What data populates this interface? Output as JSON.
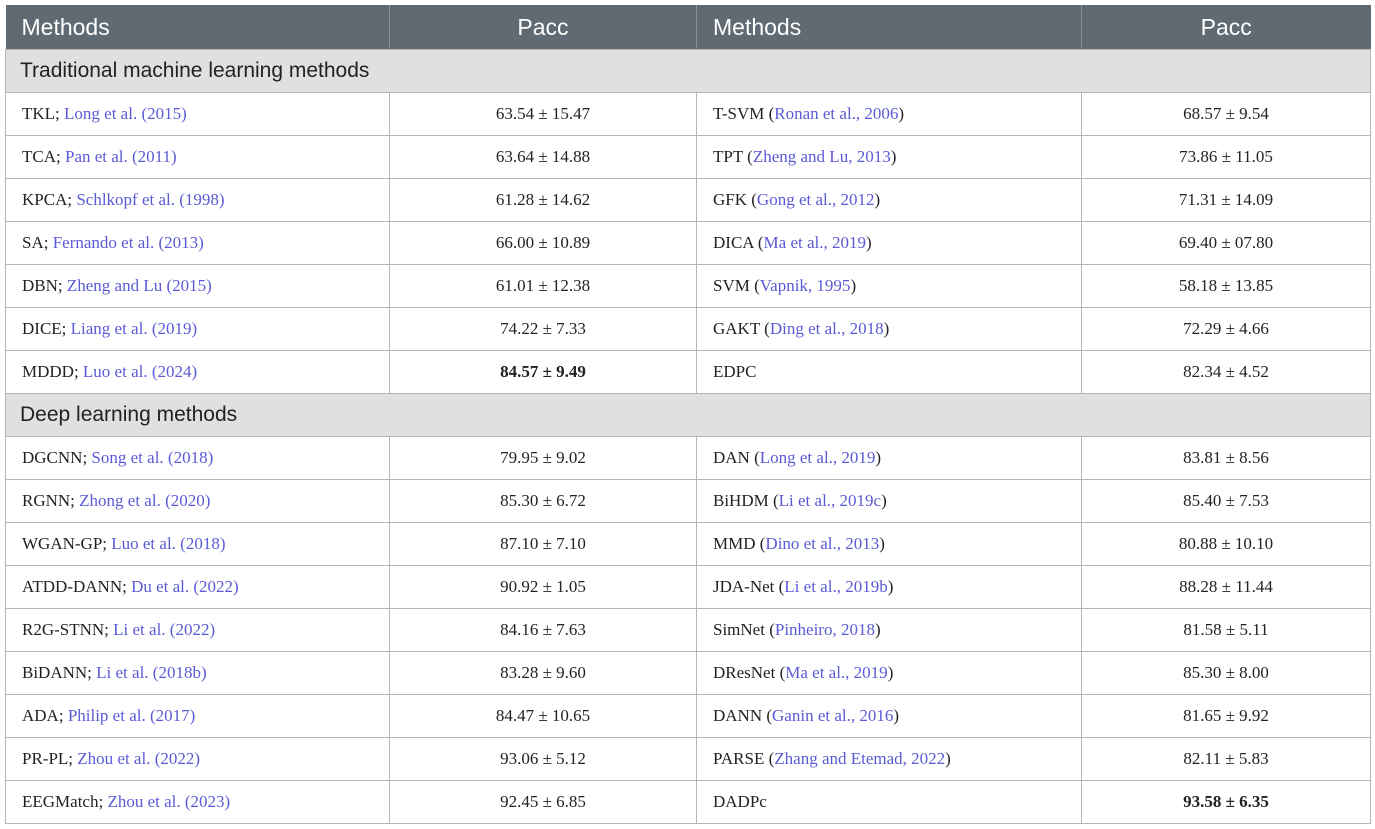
{
  "headers": [
    "Methods",
    "Pacc",
    "Methods",
    "Pacc"
  ],
  "sections": [
    {
      "title": "Traditional machine learning methods",
      "rows": [
        {
          "m1": "TKL; ",
          "r1": "Long et al. (2015)",
          "e1": "",
          "v1": "63.54 ± 15.47",
          "b1": false,
          "m2": "T-SVM (",
          "r2": "Ronan et al., 2006",
          "e2": ")",
          "v2": "68.57 ± 9.54",
          "b2": false
        },
        {
          "m1": "TCA; ",
          "r1": "Pan et al. (2011)",
          "e1": "",
          "v1": "63.64 ± 14.88",
          "b1": false,
          "m2": "TPT (",
          "r2": "Zheng and Lu, 2013",
          "e2": ")",
          "v2": "73.86 ± 11.05",
          "b2": false
        },
        {
          "m1": "KPCA; ",
          "r1": "Schlkopf et al. (1998)",
          "e1": "",
          "v1": "61.28 ± 14.62",
          "b1": false,
          "m2": "GFK (",
          "r2": "Gong et al., 2012",
          "e2": ")",
          "v2": "71.31 ± 14.09",
          "b2": false
        },
        {
          "m1": "SA; ",
          "r1": "Fernando et al. (2013)",
          "e1": "",
          "v1": "66.00 ± 10.89",
          "b1": false,
          "m2": "DICA (",
          "r2": "Ma et al., 2019",
          "e2": ")",
          "v2": "69.40 ± 07.80",
          "b2": false
        },
        {
          "m1": "DBN; ",
          "r1": "Zheng and Lu (2015)",
          "e1": "",
          "v1": "61.01 ± 12.38",
          "b1": false,
          "m2": "SVM (",
          "r2": "Vapnik, 1995",
          "e2": ")",
          "v2": "58.18 ± 13.85",
          "b2": false
        },
        {
          "m1": "DICE; ",
          "r1": "Liang et al. (2019)",
          "e1": "",
          "v1": "74.22 ± 7.33",
          "b1": false,
          "m2": "GAKT (",
          "r2": "Ding et al., 2018",
          "e2": ")",
          "v2": "72.29 ± 4.66",
          "b2": false
        },
        {
          "m1": "MDDD; ",
          "r1": "Luo et al. (2024)",
          "e1": "",
          "v1": "84.57 ± 9.49",
          "b1": true,
          "m2": "EDPC",
          "r2": "",
          "e2": "",
          "v2": "82.34 ± 4.52",
          "b2": false
        }
      ]
    },
    {
      "title": "Deep learning methods",
      "rows": [
        {
          "m1": "DGCNN; ",
          "r1": "Song et al. (2018)",
          "e1": "",
          "v1": "79.95 ± 9.02",
          "b1": false,
          "m2": "DAN (",
          "r2": "Long et al., 2019",
          "e2": ")",
          "v2": "83.81 ± 8.56",
          "b2": false
        },
        {
          "m1": "RGNN; ",
          "r1": "Zhong et al. (2020)",
          "e1": "",
          "v1": "85.30 ± 6.72",
          "b1": false,
          "m2": "BiHDM (",
          "r2": "Li et al., 2019c",
          "e2": ")",
          "v2": "85.40 ± 7.53",
          "b2": false
        },
        {
          "m1": "WGAN-GP; ",
          "r1": "Luo et al. (2018)",
          "e1": "",
          "v1": "87.10 ± 7.10",
          "b1": false,
          "m2": "MMD (",
          "r2": "Dino et al., 2013",
          "e2": ")",
          "v2": "80.88 ± 10.10",
          "b2": false
        },
        {
          "m1": "ATDD-DANN; ",
          "r1": "Du et al. (2022)",
          "e1": "",
          "v1": "90.92 ± 1.05",
          "b1": false,
          "m2": "JDA-Net (",
          "r2": "Li et al., 2019b",
          "e2": ")",
          "v2": "88.28 ± 11.44",
          "b2": false
        },
        {
          "m1": "R2G-STNN; ",
          "r1": "Li et al. (2022)",
          "e1": "",
          "v1": "84.16 ± 7.63",
          "b1": false,
          "m2": "SimNet (",
          "r2": "Pinheiro, 2018",
          "e2": ")",
          "v2": "81.58 ± 5.11",
          "b2": false
        },
        {
          "m1": "BiDANN; ",
          "r1": "Li et al. (2018b)",
          "e1": "",
          "v1": "83.28 ± 9.60",
          "b1": false,
          "m2": "DResNet (",
          "r2": "Ma et al., 2019",
          "e2": ")",
          "v2": "85.30 ± 8.00",
          "b2": false
        },
        {
          "m1": "ADA; ",
          "r1": "Philip et al. (2017)",
          "e1": "",
          "v1": "84.47 ± 10.65",
          "b1": false,
          "m2": "DANN (",
          "r2": "Ganin et al., 2016",
          "e2": ")",
          "v2": "81.65 ± 9.92",
          "b2": false
        },
        {
          "m1": "PR-PL; ",
          "r1": "Zhou et al. (2022)",
          "e1": "",
          "v1": "93.06 ± 5.12",
          "b1": false,
          "m2": "PARSE (",
          "r2": "Zhang and Etemad, 2022",
          "e2": ")",
          "v2": "82.11 ± 5.83",
          "b2": false
        },
        {
          "m1": "EEGMatch; ",
          "r1": "Zhou et al. (2023)",
          "e1": "",
          "v1": "92.45 ± 6.85",
          "b1": false,
          "m2": "DADPc",
          "r2": "",
          "e2": "",
          "v2": "93.58 ± 6.35",
          "b2": true
        }
      ]
    }
  ]
}
